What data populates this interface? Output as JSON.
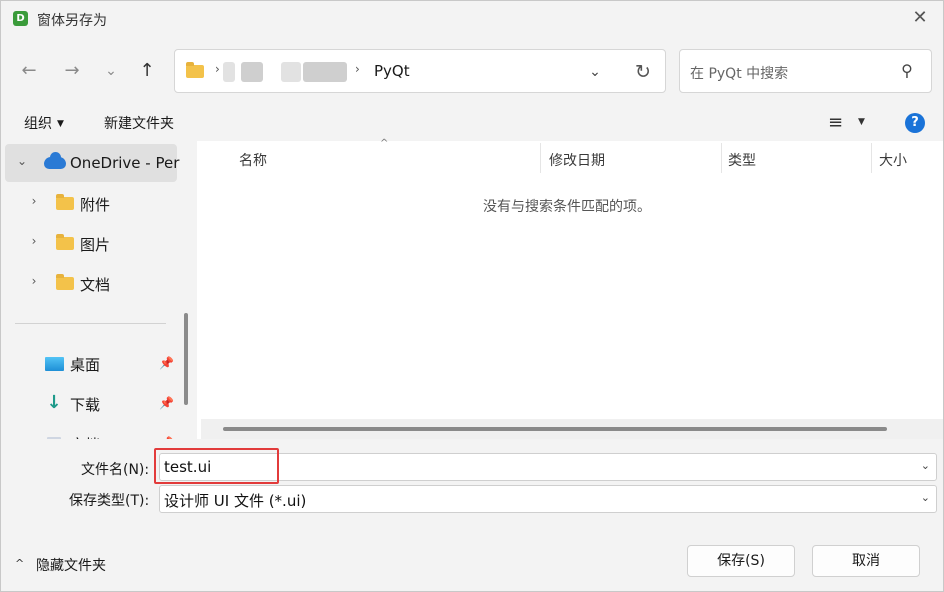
{
  "window": {
    "title": "窗体另存为",
    "app_icon_letter": "D"
  },
  "nav": {
    "back_icon": "arrow-left-icon",
    "forward_icon": "arrow-right-icon",
    "recent_icon": "chevron-down-icon",
    "up_icon": "arrow-up-icon"
  },
  "address": {
    "separator": "›",
    "current": "PyQt"
  },
  "search": {
    "placeholder": "在 PyQt 中搜索"
  },
  "commands": {
    "organize": "组织",
    "new_folder": "新建文件夹"
  },
  "sidebar": {
    "items": [
      {
        "label": "OneDrive - Per",
        "icon": "onedrive-cloud-icon"
      },
      {
        "label": "附件",
        "icon": "folder-icon"
      },
      {
        "label": "图片",
        "icon": "folder-icon"
      },
      {
        "label": "文档",
        "icon": "folder-icon"
      },
      {
        "label": "桌面",
        "icon": "desktop-icon"
      },
      {
        "label": "下载",
        "icon": "download-icon"
      },
      {
        "label": "文档",
        "icon": "document-icon"
      }
    ]
  },
  "columns": {
    "name": "名称",
    "modified": "修改日期",
    "type": "类型",
    "size": "大小"
  },
  "empty_message": "没有与搜索条件匹配的项。",
  "form": {
    "filename_label": "文件名(N):",
    "filename_value": "test.ui",
    "filetype_label": "保存类型(T):",
    "filetype_value": "设计师 UI 文件 (*.ui)"
  },
  "footer": {
    "hide_folders": "隐藏文件夹",
    "save": "保存(S)",
    "cancel": "取消"
  },
  "colors": {
    "accent": "#1a73d8",
    "highlight": "#e23b3b",
    "folder": "#f3c24a"
  }
}
